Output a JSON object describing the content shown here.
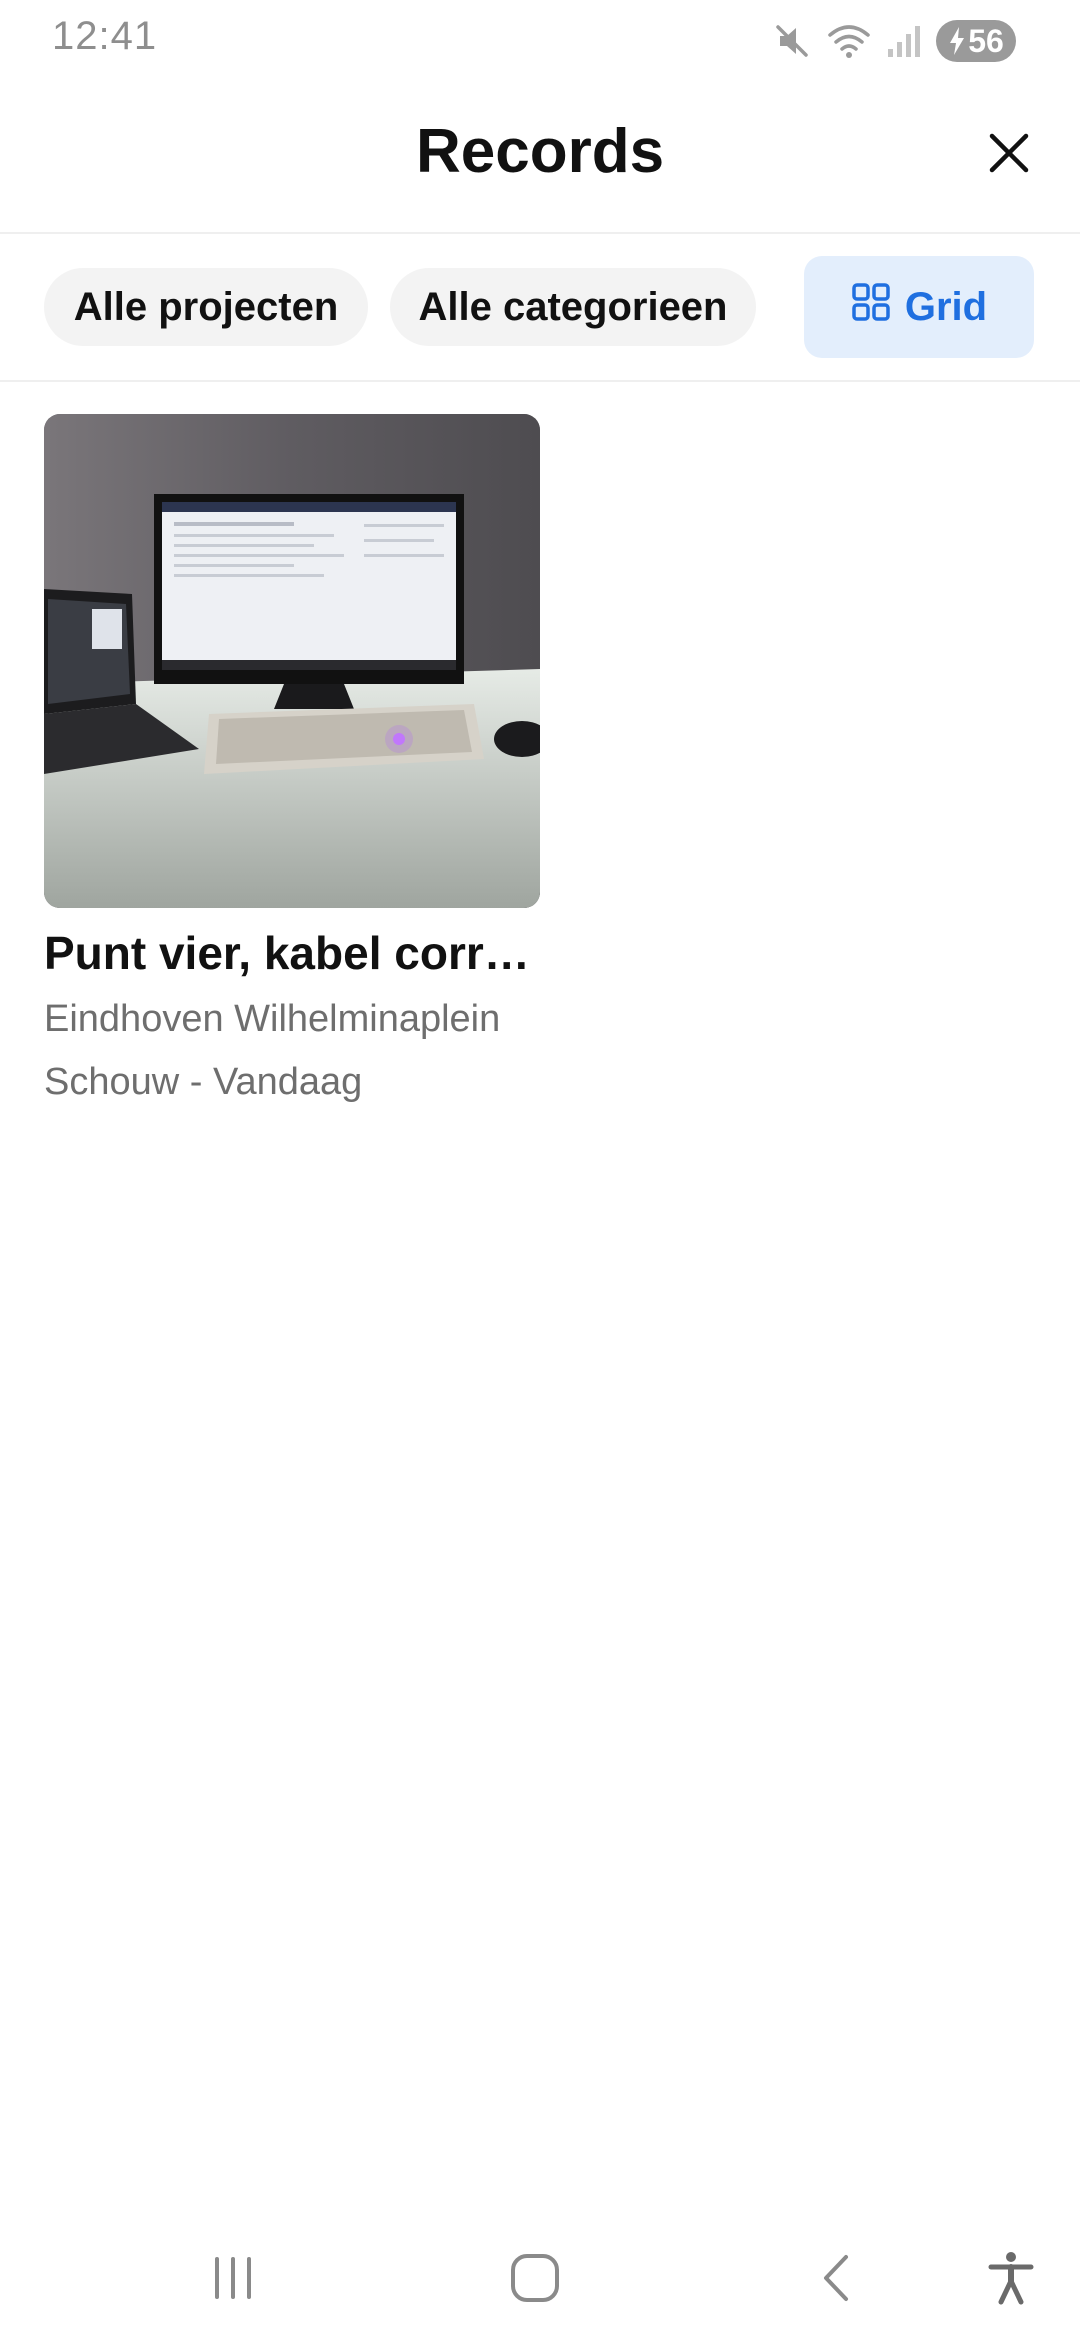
{
  "status_bar": {
    "time": "12:41",
    "battery": "56",
    "icons": [
      "mute-icon",
      "wifi-icon",
      "signal-icon",
      "battery-charging-icon"
    ]
  },
  "header": {
    "title": "Records",
    "close_icon": "close-icon"
  },
  "filters": {
    "projects_label": "Alle projecten",
    "categories_label": "Alle categorieen",
    "view_label": "Grid",
    "view_icon": "grid-icon"
  },
  "records": [
    {
      "title": "Punt vier, kabel correctie",
      "location": "Eindhoven Wilhelminaplein",
      "category_date": "Schouw - Vandaag"
    }
  ],
  "nav_bar": {
    "icons": [
      "recent-apps-icon",
      "home-icon",
      "back-icon",
      "accessibility-icon"
    ]
  },
  "colors": {
    "accent": "#1f6fe0",
    "accent_bg": "#e3eefc",
    "chip_bg": "#f3f3f3",
    "muted_text": "#6e6e6e"
  }
}
